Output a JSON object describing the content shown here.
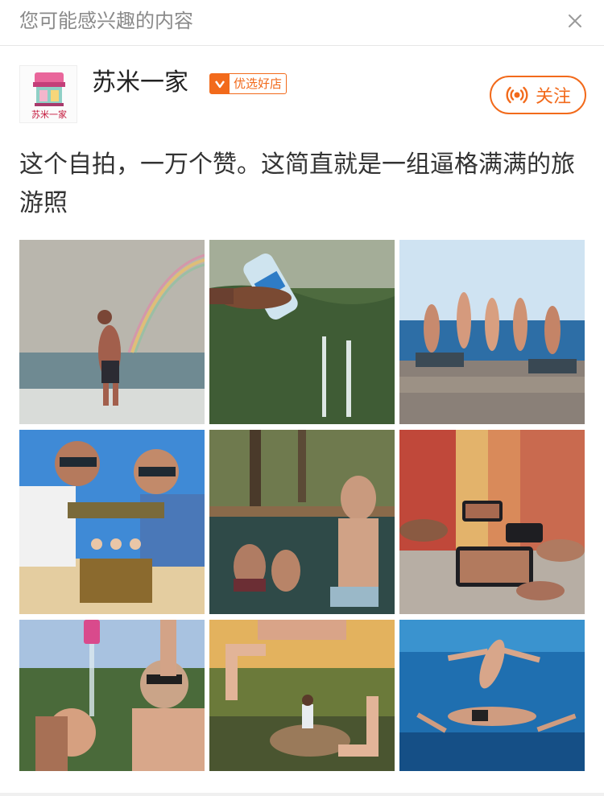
{
  "header": {
    "title": "您可能感兴趣的内容",
    "close_icon": "close-icon"
  },
  "author": {
    "name": "苏米一家",
    "avatar_text": "苏米一家",
    "badge_label": "优选好店",
    "badge_icon": "v-check-icon",
    "follow_label": "关注",
    "follow_icon": "broadcast-icon"
  },
  "post": {
    "text": "这个自拍，一万个赞。这简直就是一组逼格满满的旅游照"
  },
  "colors": {
    "accent": "#f26a1b",
    "title_gray": "#8a8a8a",
    "text": "#333333"
  },
  "photos": [
    "beach-rainbow-photo",
    "water-bottle-waterfall-photo",
    "group-pose-beach-photo",
    "treasure-chest-beach-photo",
    "split-underwater-jungle-photo",
    "phone-street-photo",
    "bottle-pour-photo",
    "finger-frame-photo",
    "underwater-stack-photo"
  ]
}
